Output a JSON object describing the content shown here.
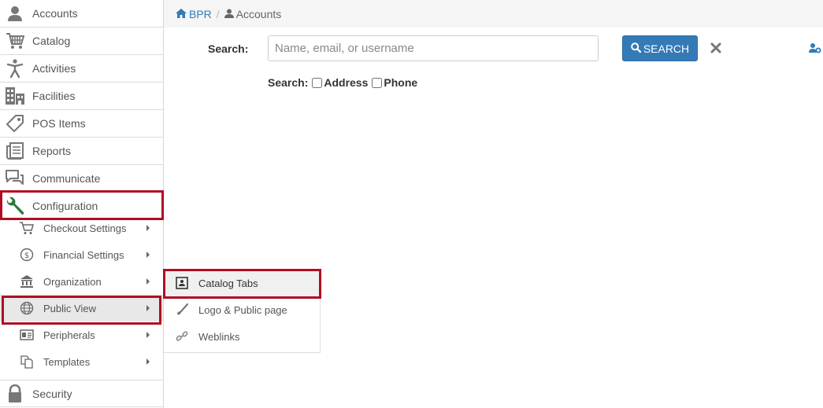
{
  "sidebar": {
    "items": [
      {
        "label": "Accounts",
        "icon": "user-icon"
      },
      {
        "label": "Catalog",
        "icon": "cart-icon"
      },
      {
        "label": "Activities",
        "icon": "person-activity-icon"
      },
      {
        "label": "Facilities",
        "icon": "building-icon"
      },
      {
        "label": "POS Items",
        "icon": "tag-icon"
      },
      {
        "label": "Reports",
        "icon": "report-icon"
      },
      {
        "label": "Communicate",
        "icon": "chat-icon"
      },
      {
        "label": "Configuration",
        "icon": "wrench-icon"
      }
    ],
    "config_sub": [
      {
        "label": "Checkout Settings",
        "icon": "cart-icon"
      },
      {
        "label": "Financial Settings",
        "icon": "dollar-icon"
      },
      {
        "label": "Organization",
        "icon": "bank-icon"
      },
      {
        "label": "Public View",
        "icon": "globe-icon"
      },
      {
        "label": "Peripherals",
        "icon": "id-card-icon"
      },
      {
        "label": "Templates",
        "icon": "copy-icon"
      }
    ],
    "security": {
      "label": "Security",
      "icon": "lock-icon"
    }
  },
  "breadcrumb": {
    "home": "BPR",
    "separator": "/",
    "current": "Accounts"
  },
  "search": {
    "label": "Search:",
    "placeholder": "Name, email, or username",
    "value": "",
    "button_label": "SEARCH",
    "options_label": "Search:",
    "options": [
      {
        "label": "Address",
        "checked": false
      },
      {
        "label": "Phone",
        "checked": false
      }
    ]
  },
  "flyout": {
    "items": [
      {
        "label": "Catalog Tabs",
        "icon": "contact-card-icon"
      },
      {
        "label": "Logo & Public page",
        "icon": "brush-icon"
      },
      {
        "label": "Weblinks",
        "icon": "link-icon"
      }
    ]
  },
  "colors": {
    "accent": "#337ab7",
    "highlight": "#b00d23",
    "wrench": "#2a7a3a"
  }
}
